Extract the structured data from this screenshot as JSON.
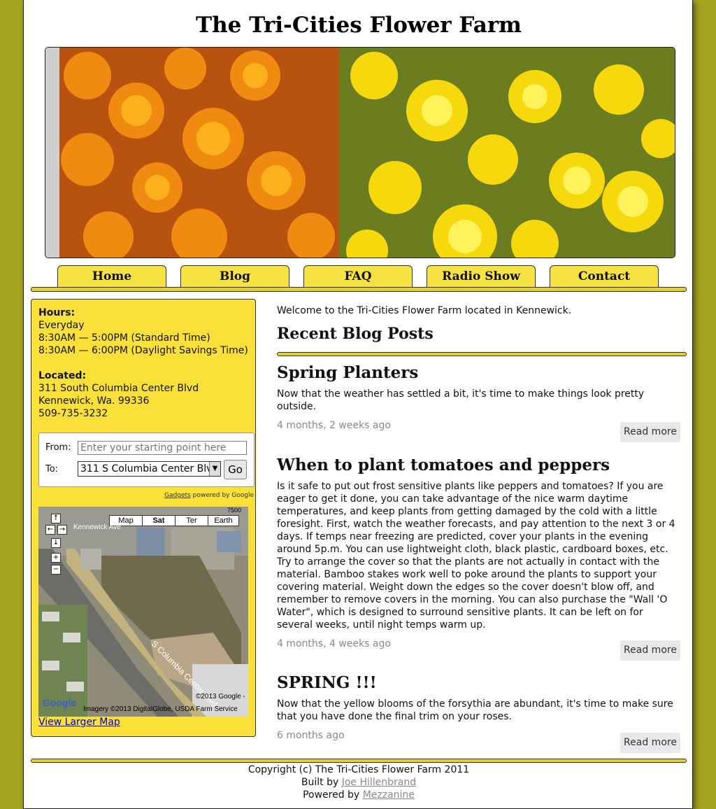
{
  "site": {
    "title": "The Tri-Cities Flower Farm"
  },
  "nav": {
    "items": [
      "Home",
      "Blog",
      "FAQ",
      "Radio Show",
      "Contact"
    ]
  },
  "sidebar": {
    "hours_label": "Hours:",
    "hours_lines": [
      "Everyday",
      "8:30AM — 5:00PM (Standard Time)",
      "8:30AM — 6:00PM (Daylight Savings Time)"
    ],
    "located_label": "Located:",
    "address_lines": [
      "311 South Columbia Center Blvd",
      "Kennewick, Wa. 99336",
      "509-735-3232"
    ],
    "directions": {
      "from_label": "From:",
      "from_placeholder": "Enter your starting point here",
      "to_label": "To:",
      "to_value": "311 S Columbia Center Blvd",
      "go_label": "Go"
    },
    "gadgets": {
      "link": "Gadgets",
      "text": "powered by Google"
    },
    "map": {
      "types": [
        "Map",
        "Sat",
        "Ter",
        "Earth"
      ],
      "selected_type": "Sat",
      "scale": "7500",
      "copyright_google": "©2013 Google -",
      "imagery_credit": "Imagery ©2013 DigitalGlobe, USDA Farm Service",
      "street_kennewick": "Kennewick Ave",
      "street_columbia": "S Columbia Center Blvd",
      "logo": "Google"
    },
    "view_larger_map": "View Larger Map"
  },
  "main": {
    "welcome": "Welcome to the Tri-Cities Flower Farm located in Kennewick.",
    "recent_heading": "Recent Blog Posts",
    "read_more": "Read more",
    "posts": [
      {
        "title": "Spring Planters",
        "body": "Now that the weather has settled a bit, it's time to make things look pretty outside.",
        "date": "4 months, 2 weeks ago"
      },
      {
        "title": "When to plant tomatoes and peppers",
        "body": "Is it safe to put out frost sensitive plants like peppers and tomatoes? If you are eager to get it done, you can take advantage of the nice warm daytime temperatures, and keep plants from getting damaged by the cold with a little foresight. First, watch the weather forecasts, and pay attention to the next 3 or 4 days. If temps near freezing are predicted, cover your plants in the evening around 5p.m. You can use lightweight cloth, black plastic, cardboard boxes, etc. Try to arrange the cover so that the plants are not actually in contact with the material. Bamboo stakes work well to poke around the plants to support your covering material. Weight down the edges so the cover doesn't blow off, and remember to remove covers in the morning. You can also purchase the \"Wall 'O Water\", which is designed to surround sensitive plants. It can be left on for several weeks, until night temps warm up.",
        "date": "4 months, 4 weeks ago"
      },
      {
        "title": "SPRING !!!",
        "body": "Now that the yellow blooms of the forsythia are abundant, it's time to make sure that you have done the final trim on your roses.",
        "date": "6 months ago"
      }
    ]
  },
  "footer": {
    "copyright": "Copyright (c) The Tri-Cities Flower Farm 2011",
    "built_by_prefix": "Built by",
    "built_by_link": "Joe Hillenbrand",
    "powered_by_prefix": "Powered by",
    "powered_by_link": "Mezzanine"
  },
  "colors": {
    "background": "#a6a521",
    "accent_yellow": "#fbe039",
    "tab_yellow": "#f7e244"
  }
}
